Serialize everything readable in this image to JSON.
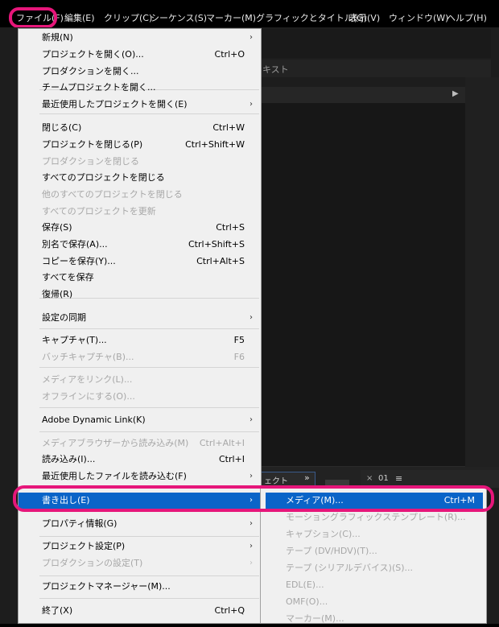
{
  "menubar": {
    "items": [
      "ファイル(F)",
      "編集(E)",
      "クリップ(C)",
      "シーケンス(S)",
      "マーカー(M)",
      "グラフィックとタイトル(G)",
      "表示(V)",
      "ウィンドウ(W)",
      "ヘルプ(H)"
    ]
  },
  "background": {
    "panel_tab": "キスト",
    "lower_tab_a": "ェクト",
    "lower_tab_a_chevron": "»",
    "lower_tab_b_close": "×",
    "lower_tab_b_label": "01",
    "lower_tab_b_menu": "≡"
  },
  "file_menu": {
    "items": [
      {
        "label": "新規(N)",
        "shortcut": "",
        "submenu": true,
        "disabled": false
      },
      {
        "label": "プロジェクトを開く(O)...",
        "shortcut": "Ctrl+O",
        "submenu": false,
        "disabled": false
      },
      {
        "label": "プロダクションを開く...",
        "shortcut": "",
        "submenu": false,
        "disabled": false
      },
      {
        "label": "チームプロジェクトを開く...",
        "shortcut": "",
        "submenu": false,
        "disabled": false
      },
      {
        "label": "最近使用したプロジェクトを開く(E)",
        "shortcut": "",
        "submenu": true,
        "disabled": false
      },
      {
        "label": "閉じる(C)",
        "shortcut": "Ctrl+W",
        "submenu": false,
        "disabled": false
      },
      {
        "label": "プロジェクトを閉じる(P)",
        "shortcut": "Ctrl+Shift+W",
        "submenu": false,
        "disabled": false
      },
      {
        "label": "プロダクションを閉じる",
        "shortcut": "",
        "submenu": false,
        "disabled": true
      },
      {
        "label": "すべてのプロジェクトを閉じる",
        "shortcut": "",
        "submenu": false,
        "disabled": false
      },
      {
        "label": "他のすべてのプロジェクトを閉じる",
        "shortcut": "",
        "submenu": false,
        "disabled": true
      },
      {
        "label": "すべてのプロジェクトを更新",
        "shortcut": "",
        "submenu": false,
        "disabled": true
      },
      {
        "label": "保存(S)",
        "shortcut": "Ctrl+S",
        "submenu": false,
        "disabled": false
      },
      {
        "label": "別名で保存(A)...",
        "shortcut": "Ctrl+Shift+S",
        "submenu": false,
        "disabled": false
      },
      {
        "label": "コピーを保存(Y)...",
        "shortcut": "Ctrl+Alt+S",
        "submenu": false,
        "disabled": false
      },
      {
        "label": "すべてを保存",
        "shortcut": "",
        "submenu": false,
        "disabled": false
      },
      {
        "label": "復帰(R)",
        "shortcut": "",
        "submenu": false,
        "disabled": false
      },
      {
        "label": "設定の同期",
        "shortcut": "",
        "submenu": true,
        "disabled": false
      },
      {
        "label": "キャプチャ(T)...",
        "shortcut": "F5",
        "submenu": false,
        "disabled": false
      },
      {
        "label": "バッチキャプチャ(B)...",
        "shortcut": "F6",
        "submenu": false,
        "disabled": true
      },
      {
        "label": "メディアをリンク(L)...",
        "shortcut": "",
        "submenu": false,
        "disabled": true
      },
      {
        "label": "オフラインにする(O)...",
        "shortcut": "",
        "submenu": false,
        "disabled": true
      },
      {
        "label": "Adobe Dynamic Link(K)",
        "shortcut": "",
        "submenu": true,
        "disabled": false
      },
      {
        "label": "メディアブラウザーから読み込み(M)",
        "shortcut": "Ctrl+Alt+I",
        "submenu": false,
        "disabled": true
      },
      {
        "label": "読み込み(I)...",
        "shortcut": "Ctrl+I",
        "submenu": false,
        "disabled": false
      },
      {
        "label": "最近使用したファイルを読み込む(F)",
        "shortcut": "",
        "submenu": true,
        "disabled": false
      },
      {
        "label": "書き出し(E)",
        "shortcut": "",
        "submenu": true,
        "disabled": false,
        "selected": true
      },
      {
        "label": "プロパティ情報(G)",
        "shortcut": "",
        "submenu": true,
        "disabled": false
      },
      {
        "label": "プロジェクト設定(P)",
        "shortcut": "",
        "submenu": true,
        "disabled": false
      },
      {
        "label": "プロダクションの設定(T)",
        "shortcut": "",
        "submenu": true,
        "disabled": true
      },
      {
        "label": "プロジェクトマネージャー(M)...",
        "shortcut": "",
        "submenu": false,
        "disabled": false
      },
      {
        "label": "終了(X)",
        "shortcut": "Ctrl+Q",
        "submenu": false,
        "disabled": false
      }
    ]
  },
  "export_submenu": {
    "items": [
      {
        "label": "メディア(M)...",
        "shortcut": "Ctrl+M",
        "selected": true,
        "disabled": false
      },
      {
        "label": "モーショングラフィックステンプレート(R)...",
        "shortcut": "",
        "disabled": true
      },
      {
        "label": "キャプション(C)...",
        "shortcut": "",
        "disabled": true
      },
      {
        "label": "テープ (DV/HDV)(T)...",
        "shortcut": "",
        "disabled": true
      },
      {
        "label": "テープ (シリアルデバイス)(S)...",
        "shortcut": "",
        "disabled": true
      },
      {
        "label": "EDL(E)...",
        "shortcut": "",
        "disabled": true
      },
      {
        "label": "OMF(O)...",
        "shortcut": "",
        "disabled": true
      },
      {
        "label": "マーカー(M)...",
        "shortcut": "",
        "disabled": true
      }
    ]
  },
  "colors": {
    "highlight_outline": "#e6167a",
    "selection": "#0a64c8",
    "menu_bg": "#f0f0f0"
  }
}
